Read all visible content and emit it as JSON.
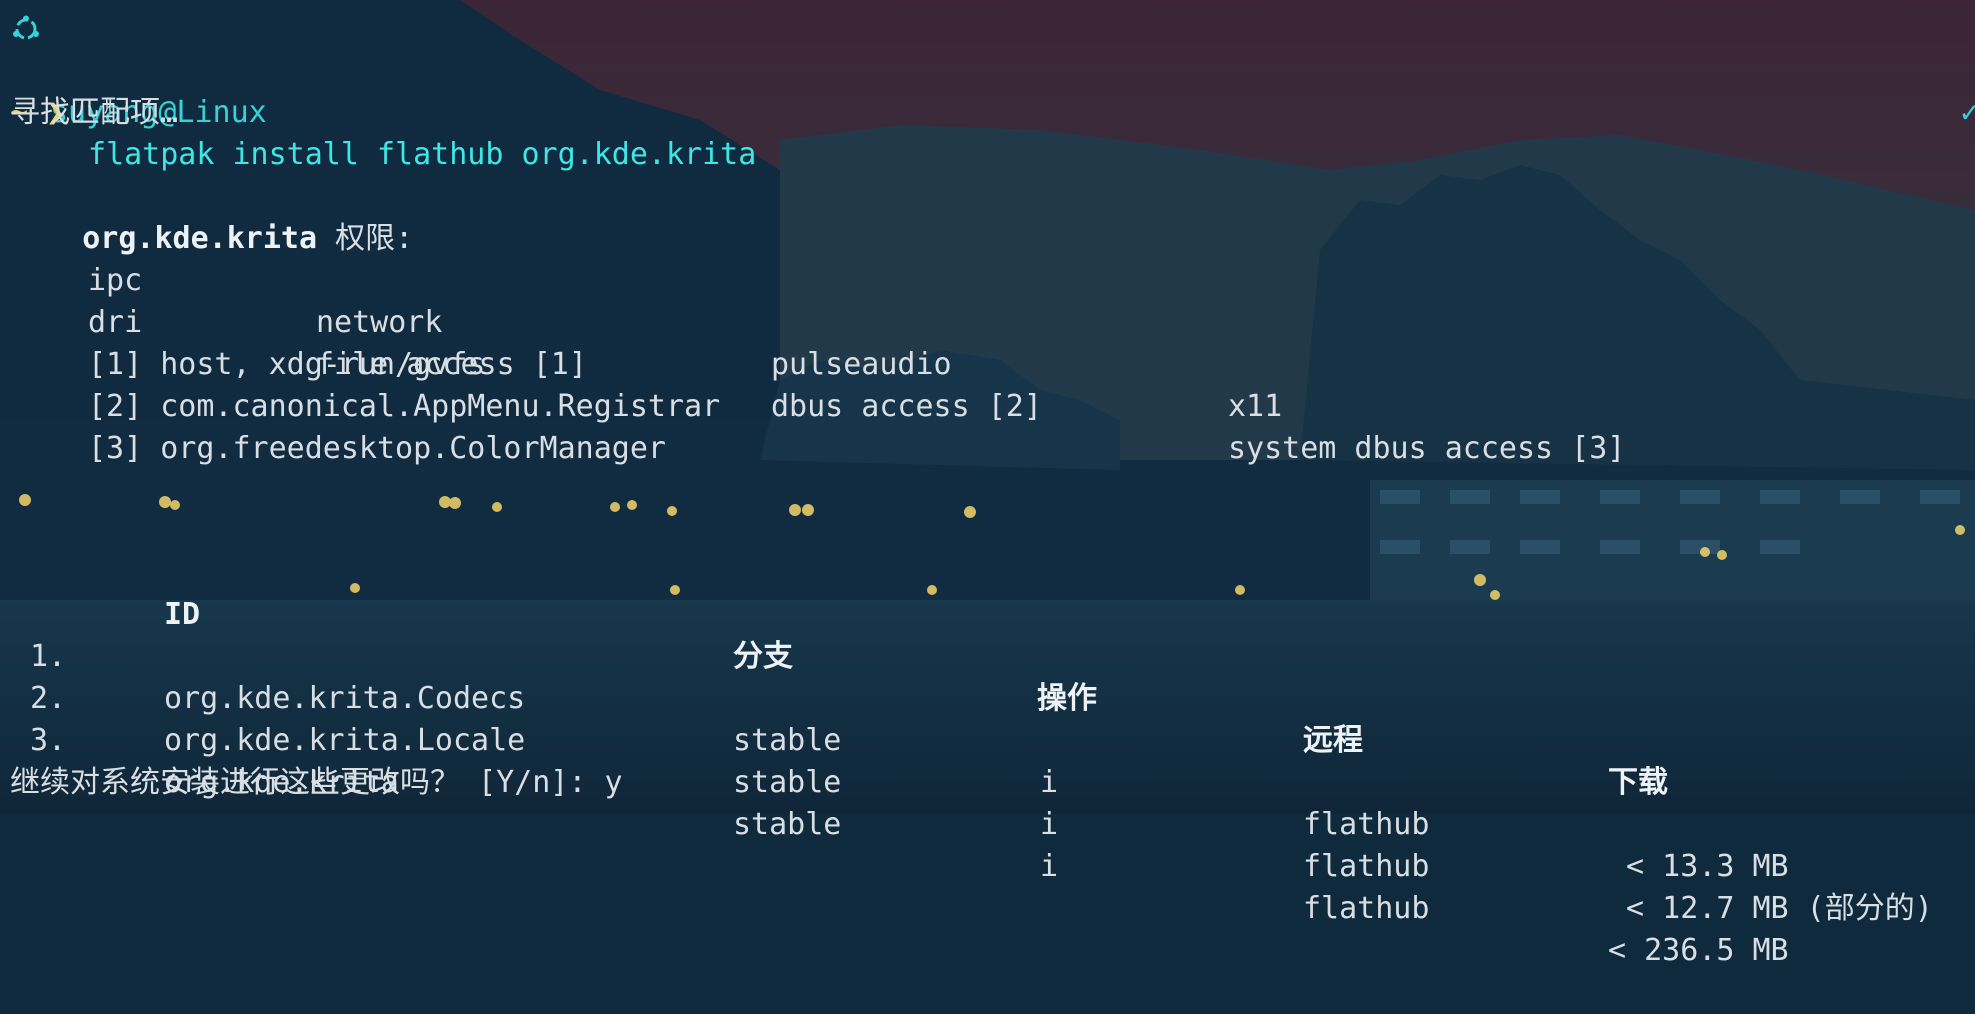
{
  "prompt_header": {
    "user_host": "suyang@Linux",
    "status": "✓ took"
  },
  "command_line": {
    "prompt": "~ ❯",
    "command": "flatpak install flathub org.kde.krita"
  },
  "searching_text": "寻找匹配项…",
  "permissions": {
    "app_id": "org.kde.krita",
    "label": " 权限:",
    "row1": [
      "ipc",
      "network",
      "pulseaudio",
      "x11"
    ],
    "row2": [
      "dri",
      "file access [1]",
      "dbus access [2]",
      "system dbus access [3]"
    ],
    "notes": [
      "[1] host, xdg-run/gvfs",
      "[2] com.canonical.AppMenu.Registrar",
      "[3] org.freedesktop.ColorManager"
    ]
  },
  "table": {
    "headers": {
      "id": "ID",
      "branch": "分支",
      "op": "操作",
      "remote": "远程",
      "download": "下载"
    },
    "rows": [
      {
        "num": "1.",
        "id": "org.kde.krita.Codecs",
        "branch": "stable",
        "op": "i",
        "remote": "flathub",
        "download": " < 13.3 MB"
      },
      {
        "num": "2.",
        "id": "org.kde.krita.Locale",
        "branch": "stable",
        "op": "i",
        "remote": "flathub",
        "download": " < 12.7 MB (部分的)"
      },
      {
        "num": "3.",
        "id": "org.kde.krita",
        "branch": "stable",
        "op": "i",
        "remote": "flathub",
        "download": "< 236.5 MB"
      }
    ]
  },
  "confirm_prompt": "继续对系统安装进行这些更改吗？ [Y/n]: y",
  "colors": {
    "background": "#0f2a3d",
    "sky": "#3a2a3b",
    "command": "#3ee6e6",
    "prompt_arrow": "#f2d15c",
    "text": "#d9dee3"
  },
  "icons": {
    "os": "ubuntu-logo-icon",
    "status": "checkmark-icon"
  }
}
